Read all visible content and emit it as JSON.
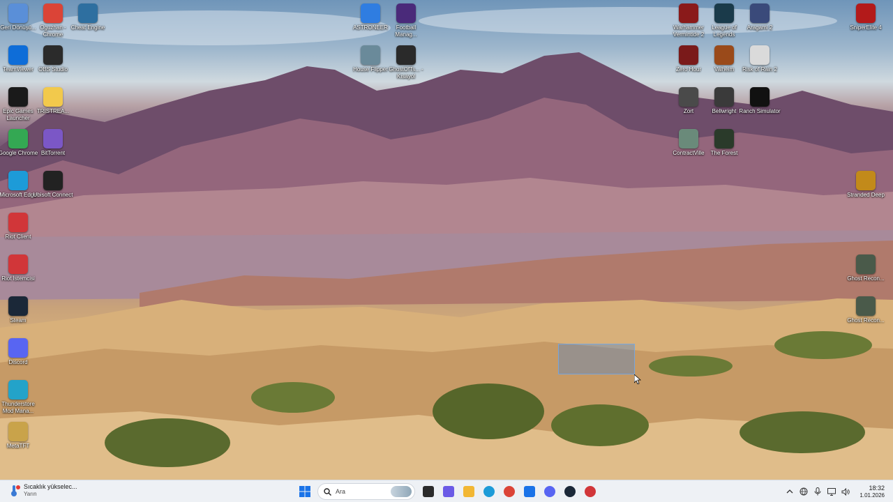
{
  "desktop": {
    "icons_left": [
      {
        "label": "Geri Dönüşü...",
        "icon": "recycle-bin-icon",
        "color": "#5a8fd8"
      },
      {
        "label": "Oguzhan - Chrome",
        "icon": "chrome-icon",
        "color": "#db4437"
      },
      {
        "label": "Cheat Engine",
        "icon": "cheat-engine-icon",
        "color": "#2e6fa0"
      },
      {
        "label": "TeamViewer",
        "icon": "teamviewer-icon",
        "color": "#0e6dd8"
      },
      {
        "label": "OBS Studio",
        "icon": "obs-icon",
        "color": "#2b2b2b"
      },
      {
        "label": "Epic Games Launcher",
        "icon": "epic-games-icon",
        "color": "#1a1a1a"
      },
      {
        "label": "TRISTREA...",
        "icon": "folder-icon",
        "color": "#f2c94c"
      },
      {
        "label": "Google Chrome",
        "icon": "chrome-icon",
        "color": "#34a853"
      },
      {
        "label": "BitTorrent",
        "icon": "bittorrent-icon",
        "color": "#7b57c6"
      },
      {
        "label": "Microsoft Edge",
        "icon": "edge-icon",
        "color": "#1d9bd8"
      },
      {
        "label": "Ubisoft Connect",
        "icon": "ubisoft-icon",
        "color": "#222"
      },
      {
        "label": "Riot Client",
        "icon": "riot-client-icon",
        "color": "#d13639"
      },
      {
        "label": "Riot İstemcisi",
        "icon": "riot-client-icon",
        "color": "#d13639"
      },
      {
        "label": "Steam",
        "icon": "steam-icon",
        "color": "#1b2838"
      },
      {
        "label": "Discord",
        "icon": "discord-icon",
        "color": "#5865f2"
      },
      {
        "label": "Thunderstore Mod Mana...",
        "icon": "thunderstore-icon",
        "color": "#23a3c9"
      },
      {
        "label": "MetaTFT",
        "icon": "metatft-icon",
        "color": "#c9a34a"
      }
    ],
    "icons_center": [
      {
        "label": "ASTRONEER",
        "icon": "astroneer-icon",
        "color": "#2f7de1"
      },
      {
        "label": "Football Manag...",
        "icon": "football-manager-icon",
        "color": "#4a2a7a"
      },
      {
        "label": "House Flipper",
        "icon": "house-flipper-icon",
        "color": "#6a8a9a"
      },
      {
        "label": "GhostOfTs... - Kısayol",
        "icon": "ghost-of-tsushima-icon",
        "color": "#2a2a2a"
      }
    ],
    "icons_right": [
      {
        "label": "Warhammer Vermintide 2",
        "icon": "vermintide-icon",
        "color": "#8a1a1a"
      },
      {
        "label": "League of Legends",
        "icon": "league-of-legends-icon",
        "color": "#1a3a4a"
      },
      {
        "label": "Aragami 2",
        "icon": "aragami-icon",
        "color": "#3a4a7a"
      },
      {
        "label": "SniperElite 4",
        "icon": "sniper-elite-icon",
        "color": "#b31a1a"
      },
      {
        "label": "Zero Hour",
        "icon": "zero-hour-icon",
        "color": "#7a1a1a"
      },
      {
        "label": "Valheim",
        "icon": "valheim-icon",
        "color": "#9a4a1a"
      },
      {
        "label": "Risk of Rain 2",
        "icon": "risk-of-rain-icon",
        "color": "#dadada"
      },
      {
        "label": "Zort",
        "icon": "zort-icon",
        "color": "#4a4a4a"
      },
      {
        "label": "Bellwright",
        "icon": "bellwright-icon",
        "color": "#3a3a3a"
      },
      {
        "label": "Ranch Simulator",
        "icon": "ranch-simulator-icon",
        "color": "#111"
      },
      {
        "label": "ContractVille",
        "icon": "contractville-icon",
        "color": "#6a8a7a"
      },
      {
        "label": "The Forest",
        "icon": "the-forest-icon",
        "color": "#2a3a2a"
      },
      {
        "label": "Stranded Deep",
        "icon": "stranded-deep-icon",
        "color": "#c28a1a"
      },
      {
        "label": "Ghost Recon...",
        "icon": "ghost-recon-icon",
        "color": "#4a5a4a"
      },
      {
        "label": "Ghost Recon...",
        "icon": "ghost-recon-icon",
        "color": "#4a5a4a"
      }
    ]
  },
  "taskbar": {
    "weather": {
      "line1": "Sıcaklık yükselec...",
      "line2": "Yarın",
      "icon": "weather-thermometer-icon"
    },
    "search": {
      "placeholder": "Ara"
    },
    "apps": [
      {
        "name": "start-button",
        "icon": "windows-logo-icon",
        "color": "#1a73e8"
      },
      {
        "name": "task-view-button",
        "icon": "task-view-icon",
        "color": "#2b2b2b"
      },
      {
        "name": "copilot-button",
        "icon": "copilot-icon",
        "color": "#6b5be6"
      },
      {
        "name": "file-explorer-button",
        "icon": "folder-icon",
        "color": "#f2b734"
      },
      {
        "name": "edge-button",
        "icon": "edge-icon",
        "color": "#1d9bd8"
      },
      {
        "name": "chrome-button",
        "icon": "chrome-icon",
        "color": "#db4437"
      },
      {
        "name": "store-button",
        "icon": "store-icon",
        "color": "#1a73e8"
      },
      {
        "name": "discord-button",
        "icon": "discord-icon",
        "color": "#5865f2"
      },
      {
        "name": "steam-button",
        "icon": "steam-icon",
        "color": "#1b2838"
      },
      {
        "name": "riot-button",
        "icon": "riot-client-icon",
        "color": "#d13639"
      }
    ],
    "tray": {
      "icons": [
        "chevron-up-icon",
        "network-globe-icon",
        "microphone-icon",
        "display-icon",
        "speaker-icon"
      ],
      "time": "18:32",
      "date": "1.01.2026"
    }
  }
}
